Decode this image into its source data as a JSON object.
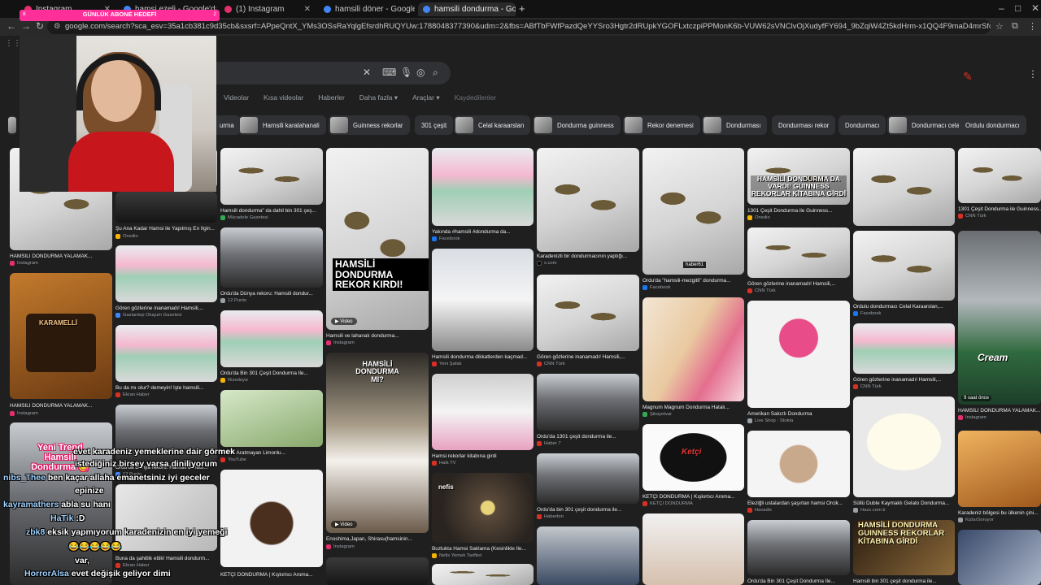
{
  "browser": {
    "tabs": [
      {
        "label": "Instagram",
        "color": "#e1306c"
      },
      {
        "label": "hamsi ezeli - Google'da Ara",
        "color": "#4285f4"
      },
      {
        "label": "(1) Instagram",
        "color": "#e1306c"
      },
      {
        "label": "hamsili döner - Google'da Ara",
        "color": "#4285f4"
      },
      {
        "label": "hamsili dondurma - Google'da",
        "color": "#4285f4"
      }
    ],
    "url": "google.com/search?sca_esv=35a1cb381c9d35cb&sxsrf=APpeQntX_YMs3OSsRaYqlgEfsrdhRUQYUw:1788048377390&udm=2&fbs=ABfTbFWfPazdQeYYSro3Hgtr2dRUpkYGOFLxtczpiPPMonK6b-VUW62sVNClvOjXudyfFY694_9bZqiW4Zt5kdHrm-x1QQ4F9maD4mrSfqzlYd7lEzDxdgOCfx1sitaAeIA7-RYw2odVAUlInCo23ljKFqLxlyRduRKEbd8FpeX7kl1m452g..."
  },
  "google": {
    "filters": [
      "Videolar",
      "Kısa videolar",
      "Haberler",
      "Daha fazla ▾",
      "Araçlar ▾",
      "Kaydedilenler"
    ],
    "chips": [
      "urma",
      "Hamsili karalahanali",
      "Guinness rekorlar",
      "301 çeşit",
      "Celal karaarslan",
      "Dondurma guinness",
      "Rekor denemesi",
      "Dondurması",
      "Dondurması rekor",
      "Dondurmacı",
      "Dondurmacı celal",
      "Ordulu dondurmacı"
    ],
    "results": [
      {
        "title": "HAMSİLİ DONDURMA YALAMAK...",
        "source": "Instagram"
      },
      {
        "title": "Şu Ana Kadar Hamsi ile Yapılmış En İlgin...",
        "source": "Onedio"
      },
      {
        "title": "Hamsili dondurma\" da dahil bin 301 çeş...",
        "source": "Mücadele Gazetesi"
      },
      {
        "title": "Hamsili ve lahanalı dondurma...",
        "source": "Instagram"
      },
      {
        "title": "Yakında #hamsili #dondurma da...",
        "source": "Facebook"
      },
      {
        "title": "Karadenizli bir dondurmacının yaptığı...",
        "source": "x.com"
      },
      {
        "title": "Ordu'da \"hamsili-mezgitli\" dondurma...",
        "source": "Facebook"
      },
      {
        "title": "1301 Çeşit Dondurma ile Guinness...",
        "source": "Onedio"
      },
      {
        "title": "Gören gözlerine inanamadı! Hamsili,...",
        "source": "CNN Türk"
      },
      {
        "title": "1301 Çeşit Dondurma ile Guinness...",
        "source": "CNN Türk"
      },
      {
        "title": "Gören gözlerine inanamadı! Hamsili,...",
        "source": "Gaziantep Oluşum Gazetesi"
      },
      {
        "title": "Ordu'da Dünya rekoru: Hamsili dondur...",
        "source": "12 Punto"
      },
      {
        "title": "Gören gözlerine inanamadı! Hamsili,...",
        "source": "CNN Türk"
      },
      {
        "title": "Ordulu dondurmacı Celal Karaarslan,...",
        "source": "Facebook"
      },
      {
        "title": "HAMSİLİ DONDURMA YALAMAK...",
        "source": "Instagram"
      },
      {
        "title": "Bu da mı olur? demeyin! İşte hamsili...",
        "source": "Ekran Haber"
      },
      {
        "title": "Ordu'da Bin 301 Çeşit Dondurma İle...",
        "source": "Rizedeyiz"
      },
      {
        "title": "Hamsili dondurma dikkatlerden kaçmad...",
        "source": "Yeni Şafak"
      },
      {
        "title": "Gören gözlerine inanamadı! Hamsili,...",
        "source": "CNN Türk"
      },
      {
        "title": "Magnum Magnum Dondurma Hatalı...",
        "source": "Şikayetvar"
      },
      {
        "title": "Amerikan Sakızlı Dondurma",
        "source": "Live Shop · Stokta"
      },
      {
        "title": "Gören gözlerine inanamadı! Hamsili,...",
        "source": "CNN Türk"
      },
      {
        "title": "HAMSİLİ DONDURMA YALAMAK...",
        "source": "Instagram"
      },
      {
        "title": "Ordu'da Dünya rekoru: Hamsili dondur...",
        "source": "12 Punto"
      },
      {
        "title": "Hamsi Aratmayan Limonlu...",
        "source": "YouTube"
      },
      {
        "title": "Hamsi rekorlar kitabına girdi",
        "source": "Halk TV"
      },
      {
        "title": "Ordu'da 1301 çeşit dondurma ile...",
        "source": "Haber 7"
      },
      {
        "title": "Süllü Duble Kaymaklı Gelato Dondurma...",
        "source": "Hazz.com.tr"
      },
      {
        "title": "Karadeniz bölgesi bu ülkenin çini...",
        "source": "KizlarSoruyor"
      },
      {
        "title": "Ordu'da bin 301 çeşit dondurma ile...",
        "source": "Haberton"
      },
      {
        "title": "Eleziğli ustalardan şaşırtan hamsi Orcik...",
        "source": "Havadis"
      },
      {
        "title": "Enoshima,Japan, Shirasu(hamsinin...",
        "source": "Instagram"
      },
      {
        "title": "Buzlukta Hamsi Saklama (Kesinlikle İle...",
        "source": "Nefis Yemek Tarifleri"
      },
      {
        "title": "KETÇİ DONDURMA | Kışkırtıcı Aroma...",
        "source": "KETÇİ DONDURMA"
      },
      {
        "title": "Buna da şahitlik ettik! Hamsili dondurm...",
        "source": "Ekran Haber"
      },
      {
        "title": "KETÇİ DONDURMA | Kışkırtıcı Aroma...",
        "source": "KETÇİ DONDURMA"
      },
      {
        "title": "Ordu'da Bin 301 Çeşit Dondurma İle...",
        "source": ""
      },
      {
        "title": "Hamsili bin 301 çeşit dondurma ile...",
        "source": ""
      }
    ],
    "image_text": {
      "guinness": "HAMSİLİ DONDURMA DA VARDI! GUINNESS REKORLAR KİTABINA GİRDİ",
      "rekor": "HAMSİLİ DONDURMA REKOR KIRDI!",
      "kr": "KARAMELLİ",
      "video": "Video",
      "hamsili_mi": "HAMSİLİ DONDURMA MI?",
      "guinness2": "HAMSİLİ DONDURMA GUINNESS REKORLAR KİTABINA GİRDİ",
      "cream": "Cream",
      "saat": "9 saat önce",
      "ketci": "Ketçi",
      "nefis": "nefis",
      "haber61": "haber61"
    }
  },
  "overlay": {
    "goal_label": "GÜNLÜK ABONE HEDEFİ",
    "goal_left": "8",
    "goal_right": "2",
    "trend": "Yeni Trend Hamsili Dondurma 😋",
    "chat": [
      {
        "nick": "",
        "text": "evet karadeniz yemeklerine dair görmek"
      },
      {
        "nick": "",
        "text": "istediğiniz birsey varsa diniliyorum"
      },
      {
        "nick": "nibs_Thee",
        "text": "ben kaçar allaha emanetsiniz iyi geceler"
      },
      {
        "nick": "",
        "text": "epinize"
      },
      {
        "nick": "kayramathers",
        "text": "abla su hanı"
      },
      {
        "nick": "HaTik",
        "text": ":D"
      },
      {
        "nick": "zbk8",
        "text": "eksik yapmıyorum karadenizin en iyi yemeği"
      },
      {
        "nick": "",
        "text": "😂😂😂😂😂"
      },
      {
        "nick": "",
        "text": "var,"
      },
      {
        "nick": "HorrorAlsa",
        "text": "evet değişik geliyor dimi"
      }
    ]
  }
}
